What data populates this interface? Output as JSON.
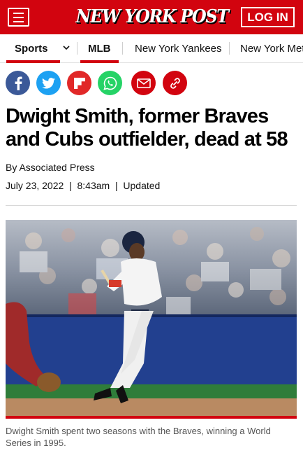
{
  "header": {
    "logo_text": "NEW YORK POST",
    "login_label": "LOG IN",
    "brand_color": "#d2040f"
  },
  "subnav": {
    "sports_label": "Sports",
    "items": [
      "MLB",
      "New York Yankees",
      "New York Mets"
    ]
  },
  "share": {
    "buttons": [
      {
        "icon": "facebook-icon",
        "color": "#3b5998"
      },
      {
        "icon": "twitter-icon",
        "color": "#1da1f2"
      },
      {
        "icon": "flipboard-icon",
        "color": "#e12828"
      },
      {
        "icon": "whatsapp-icon",
        "color": "#25d366"
      },
      {
        "icon": "email-icon",
        "color": "#d2040f"
      },
      {
        "icon": "copy-link-icon",
        "color": "#d2040f"
      }
    ]
  },
  "article": {
    "headline": "Dwight Smith, former Braves and Cubs outfielder, dead at 58",
    "byline": "By Associated Press",
    "date": "July 23, 2022",
    "time": "8:43am",
    "updated_label": "Updated",
    "caption": "Dwight Smith spent two seasons with the Braves, winning a World Series in 1995."
  }
}
